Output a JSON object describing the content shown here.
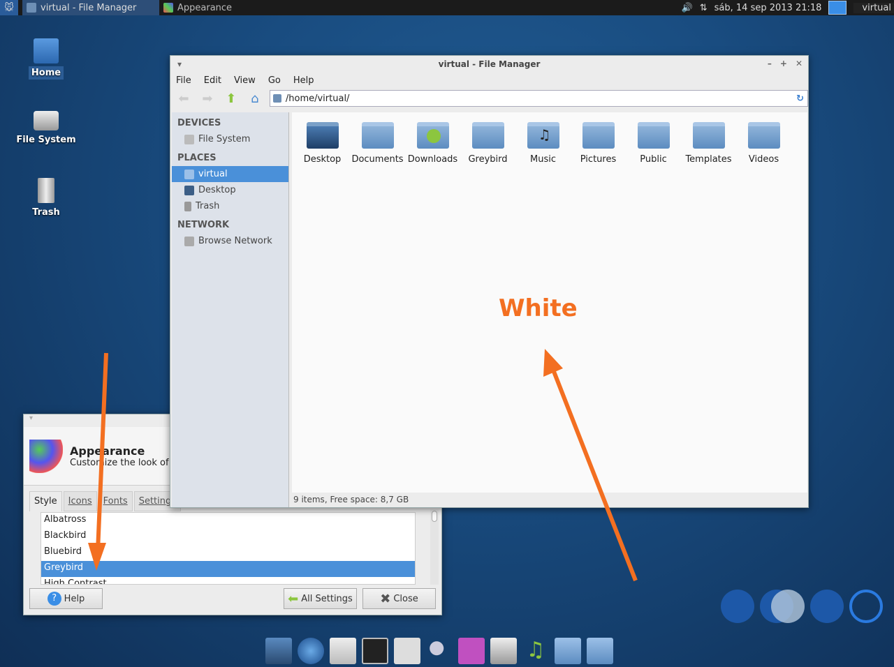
{
  "topbar": {
    "tasks": [
      {
        "label": "virtual - File Manager",
        "active": true
      },
      {
        "label": "Appearance",
        "active": false
      }
    ],
    "clock": "sáb, 14 sep 2013 21:18",
    "user": "virtual"
  },
  "desktop_icons": [
    {
      "label": "Home"
    },
    {
      "label": "File System"
    },
    {
      "label": "Trash"
    }
  ],
  "file_manager": {
    "title": "virtual - File Manager",
    "menu": [
      "File",
      "Edit",
      "View",
      "Go",
      "Help"
    ],
    "path": "/home/virtual/",
    "sidebar": {
      "devices_heading": "DEVICES",
      "devices": [
        "File System"
      ],
      "places_heading": "PLACES",
      "places": [
        "virtual",
        "Desktop",
        "Trash"
      ],
      "network_heading": "NETWORK",
      "network": [
        "Browse Network"
      ]
    },
    "files": [
      "Desktop",
      "Documents",
      "Downloads",
      "Greybird",
      "Music",
      "Pictures",
      "Public",
      "Templates",
      "Videos"
    ],
    "status": "9 items, Free space: 8,7 GB"
  },
  "appearance": {
    "title": "Appearance",
    "subtitle": "Customize the look of your desktop",
    "tabs": [
      "Style",
      "Icons",
      "Fonts",
      "Settings"
    ],
    "styles": [
      "Albatross",
      "Blackbird",
      "Bluebird",
      "Greybird",
      "High Contrast"
    ],
    "selected_style": "Greybird",
    "help_label": "Help",
    "all_settings_label": "All Settings",
    "close_label": "Close"
  },
  "annotation": {
    "text": "White",
    "color": "#f36f21"
  },
  "colors": {
    "selection": "#4a90d9",
    "accent": "#f36f21"
  }
}
